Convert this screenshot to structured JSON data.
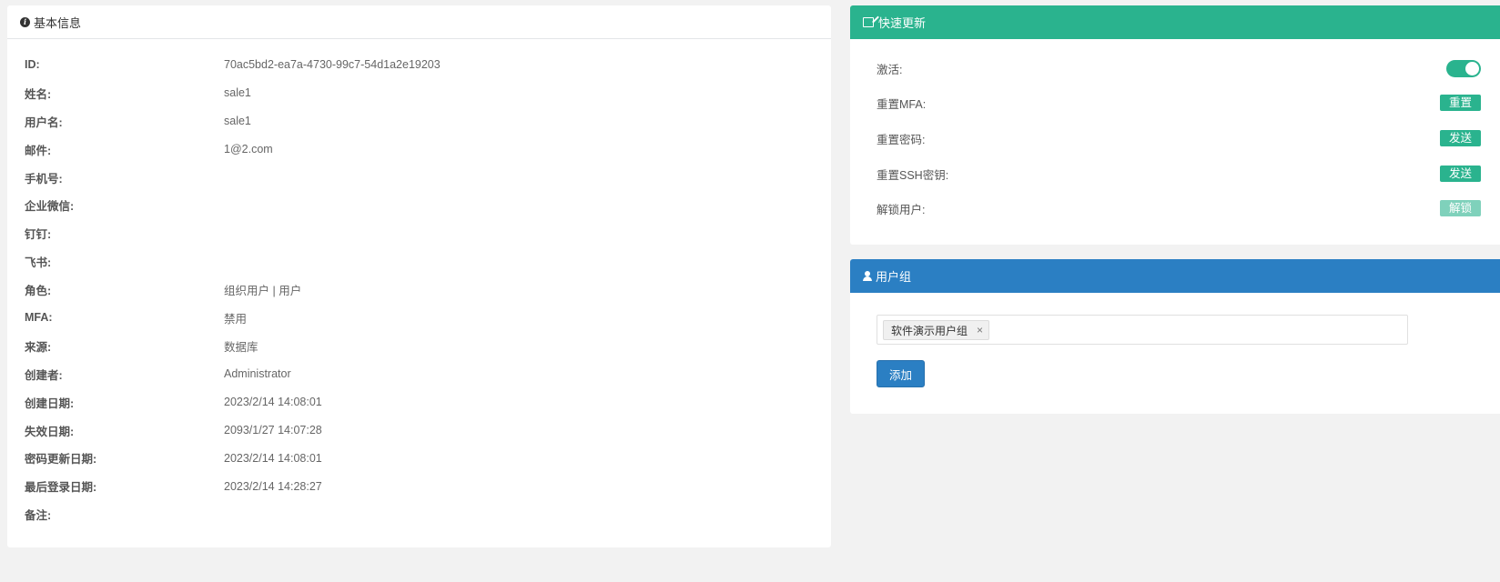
{
  "basic_info": {
    "title": "基本信息",
    "fields": [
      {
        "label": "ID:",
        "value": "70ac5bd2-ea7a-4730-99c7-54d1a2e19203"
      },
      {
        "label": "姓名:",
        "value": "sale1"
      },
      {
        "label": "用户名:",
        "value": "sale1"
      },
      {
        "label": "邮件:",
        "value": "1@2.com"
      },
      {
        "label": "手机号:",
        "value": ""
      },
      {
        "label": "企业微信:",
        "value": ""
      },
      {
        "label": "钉钉:",
        "value": ""
      },
      {
        "label": "飞书:",
        "value": ""
      },
      {
        "label": "角色:",
        "value": "组织用户 | 用户"
      },
      {
        "label": "MFA:",
        "value": "禁用"
      },
      {
        "label": "来源:",
        "value": "数据库"
      },
      {
        "label": "创建者:",
        "value": "Administrator"
      },
      {
        "label": "创建日期:",
        "value": "2023/2/14 14:08:01"
      },
      {
        "label": "失效日期:",
        "value": "2093/1/27 14:07:28"
      },
      {
        "label": "密码更新日期:",
        "value": "2023/2/14 14:08:01"
      },
      {
        "label": "最后登录日期:",
        "value": "2023/2/14 14:28:27"
      },
      {
        "label": "备注:",
        "value": ""
      }
    ]
  },
  "quick_update": {
    "title": "快速更新",
    "active_label": "激活:",
    "active_on": true,
    "reset_mfa_label": "重置MFA:",
    "reset_mfa_button": "重置",
    "reset_password_label": "重置密码:",
    "reset_password_button": "发送",
    "reset_ssh_label": "重置SSH密钥:",
    "reset_ssh_button": "发送",
    "unlock_label": "解锁用户:",
    "unlock_button": "解锁"
  },
  "user_groups": {
    "title": "用户组",
    "tags": [
      "软件演示用户组"
    ],
    "remove_symbol": "×",
    "add_button": "添加"
  },
  "colors": {
    "quick_header": "#2ab38e",
    "group_header": "#2b7fc3"
  },
  "icons": {
    "basic_info": "info-circle-icon",
    "quick_update": "edit-icon",
    "user_groups": "user-icon"
  }
}
